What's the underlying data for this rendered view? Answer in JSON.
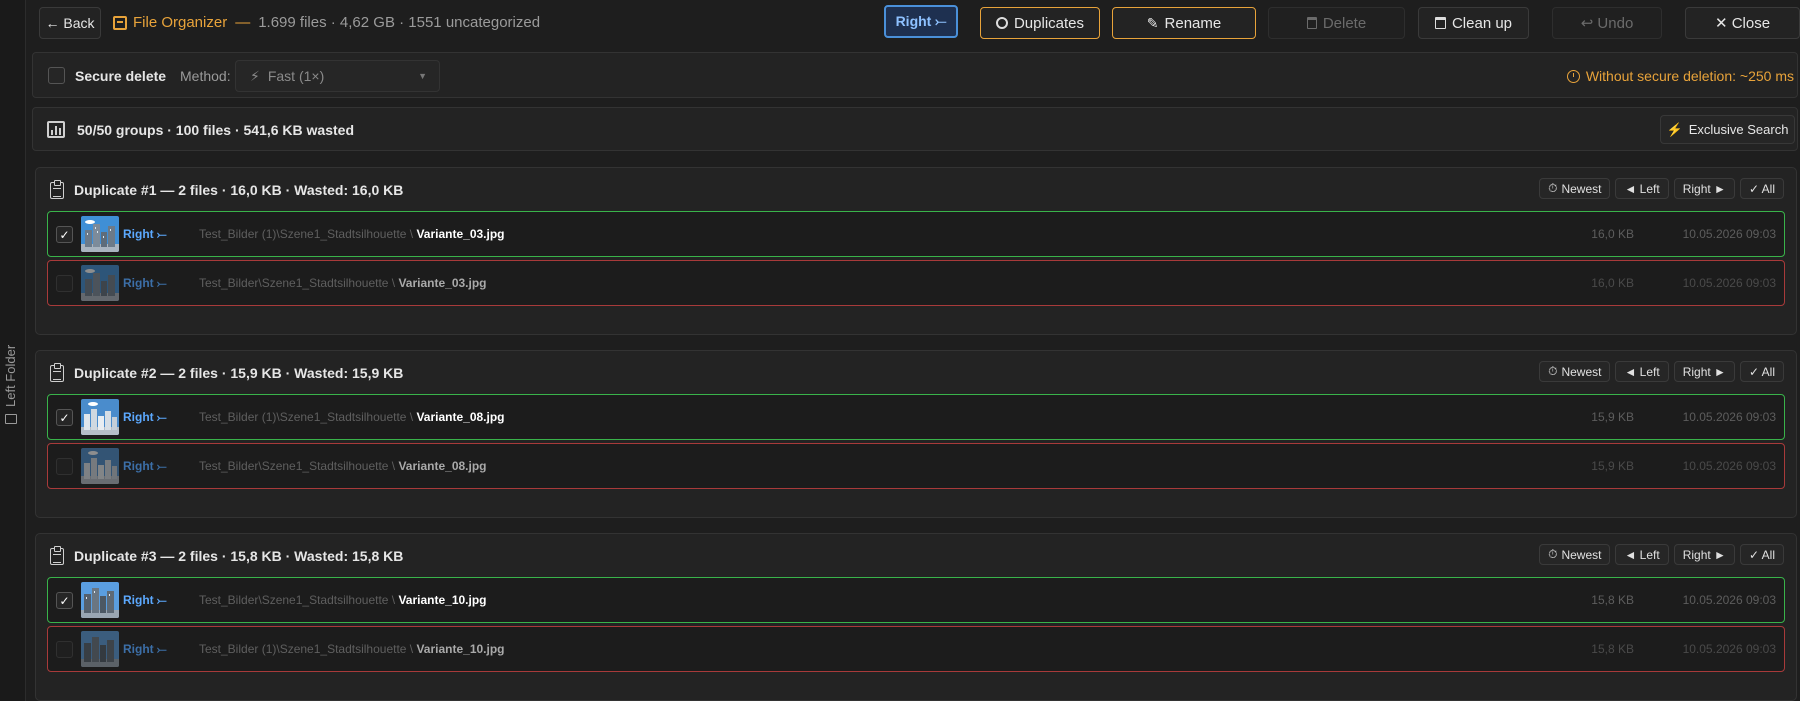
{
  "side_panel": {
    "label": "Left Folder"
  },
  "toolbar": {
    "back": "← Back",
    "app_name": "File Organizer",
    "separator": "—",
    "stats": "1.699 files · 4,62 GB · 1551 uncategorized",
    "right": "Right ⤚",
    "duplicates": "Duplicates",
    "rename": "Rename",
    "delete": "Delete",
    "cleanup": "Clean up",
    "undo": "↩ Undo",
    "close": "✕ Close"
  },
  "secure": {
    "label": "Secure delete",
    "method_label": "Method:",
    "method_value": "Fast (1×)",
    "timing": "Without secure deletion: ~250 ms",
    "checked": false
  },
  "summary": {
    "text": "50/50 groups · 100 files · 541,6 KB wasted",
    "exclusive_search": "Exclusive Search"
  },
  "group_actions": {
    "newest": "Newest",
    "left": "◄ Left",
    "right": "Right ►",
    "all": "✓ All"
  },
  "groups": [
    {
      "title": "Duplicate #1 — 2 files · 16,0 KB · Wasted: 16,0 KB",
      "rows": [
        {
          "side": "Right ⤚",
          "dir": "Test_Bilder (1)\\Szene1_Stadtsilhouette \\ ",
          "file": "Variante_03.jpg",
          "size": "16,0 KB",
          "date": "10.05.2026 09:03",
          "checked": "✓"
        },
        {
          "side": "Right ⤚",
          "dir": "Test_Bilder\\Szene1_Stadtsilhouette \\ ",
          "file": "Variante_03.jpg",
          "size": "16,0 KB",
          "date": "10.05.2026 09:03",
          "checked": ""
        }
      ]
    },
    {
      "title": "Duplicate #2 — 2 files · 15,9 KB · Wasted: 15,9 KB",
      "rows": [
        {
          "side": "Right ⤚",
          "dir": "Test_Bilder (1)\\Szene1_Stadtsilhouette \\ ",
          "file": "Variante_08.jpg",
          "size": "15,9 KB",
          "date": "10.05.2026 09:03",
          "checked": "✓"
        },
        {
          "side": "Right ⤚",
          "dir": "Test_Bilder\\Szene1_Stadtsilhouette \\ ",
          "file": "Variante_08.jpg",
          "size": "15,9 KB",
          "date": "10.05.2026 09:03",
          "checked": ""
        }
      ]
    },
    {
      "title": "Duplicate #3 — 2 files · 15,8 KB · Wasted: 15,8 KB",
      "rows": [
        {
          "side": "Right ⤚",
          "dir": "Test_Bilder\\Szene1_Stadtsilhouette \\ ",
          "file": "Variante_10.jpg",
          "size": "15,8 KB",
          "date": "10.05.2026 09:03",
          "checked": "✓"
        },
        {
          "side": "Right ⤚",
          "dir": "Test_Bilder (1)\\Szene1_Stadtsilhouette \\ ",
          "file": "Variante_10.jpg",
          "size": "15,8 KB",
          "date": "10.05.2026 09:03",
          "checked": ""
        }
      ]
    }
  ],
  "colors": {
    "accent_orange": "#e8a33a",
    "accent_blue": "#4a90d9",
    "keep_border": "#39b34a",
    "dup_border": "#a83a3a"
  }
}
